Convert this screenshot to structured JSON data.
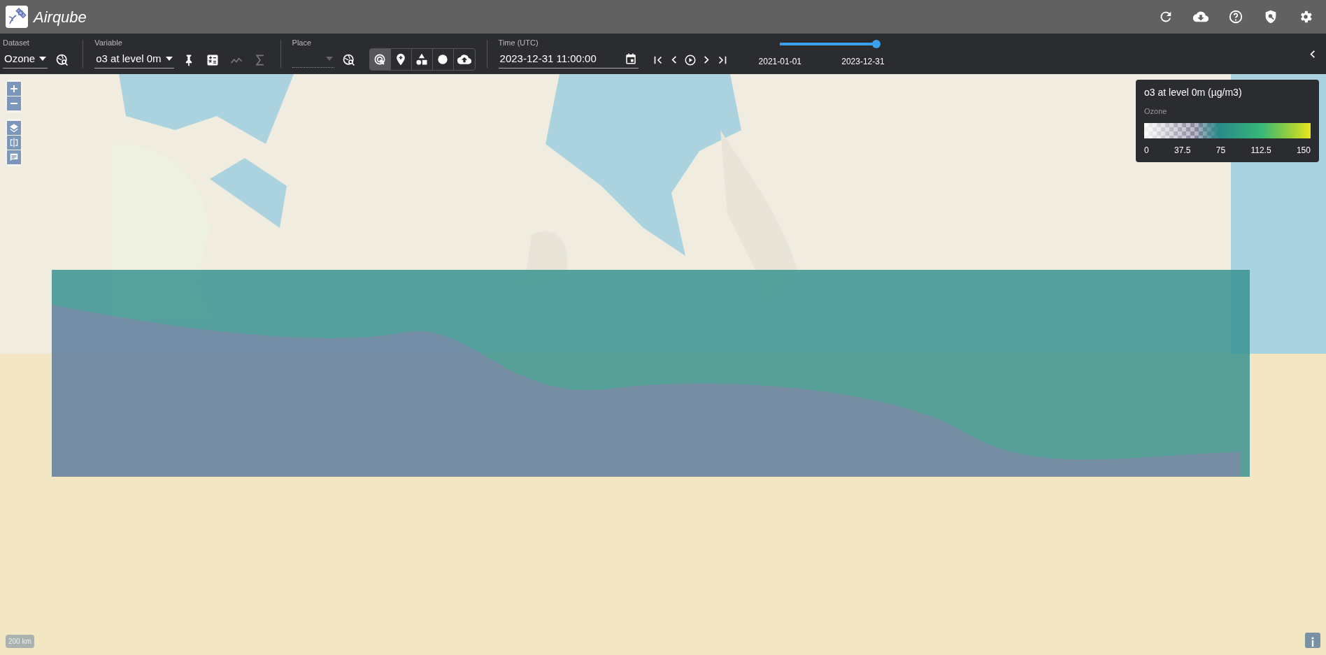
{
  "app": {
    "title": "Airqube"
  },
  "header_actions": [
    {
      "kind": "refresh"
    },
    {
      "kind": "download"
    },
    {
      "kind": "help"
    },
    {
      "kind": "shield"
    },
    {
      "kind": "settings"
    }
  ],
  "dataset": {
    "label": "Dataset",
    "value": "Ozone"
  },
  "variable": {
    "label": "Variable",
    "value": "o3 at level 0m",
    "tools": [
      {
        "kind": "pin",
        "disabled": false
      },
      {
        "kind": "calc",
        "disabled": false
      },
      {
        "kind": "chart",
        "disabled": true
      },
      {
        "kind": "sum",
        "disabled": true
      }
    ]
  },
  "place": {
    "label": "Place",
    "disabled": true
  },
  "place_tools": [
    {
      "kind": "select",
      "selected": true
    },
    {
      "kind": "point",
      "selected": false
    },
    {
      "kind": "shapes",
      "selected": false
    },
    {
      "kind": "circle",
      "selected": false
    },
    {
      "kind": "upload",
      "selected": false
    }
  ],
  "time": {
    "label": "Time (UTC)",
    "value": "2023-12-31 11:00:00",
    "nav": [
      {
        "kind": "first"
      },
      {
        "kind": "prev"
      },
      {
        "kind": "play"
      },
      {
        "kind": "next"
      },
      {
        "kind": "last"
      }
    ]
  },
  "time_range": {
    "level": 1,
    "start": "2021-01-01",
    "end": "2023-12-31"
  },
  "legend": {
    "title": "o3 at level 0m (µg/m3)",
    "subtitle": "Ozone",
    "ticks": [
      "0",
      "37.5",
      "75",
      "112.5",
      "150"
    ]
  },
  "map": {
    "scale": "200 km"
  }
}
